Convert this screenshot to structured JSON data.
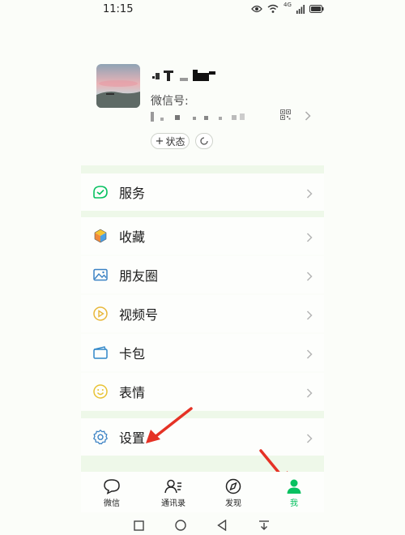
{
  "status_bar": {
    "time": "11:15",
    "network_label": "4G"
  },
  "profile": {
    "wechat_id_label": "微信号:",
    "status_button_label": "状态"
  },
  "menu": {
    "items": [
      {
        "label": "服务",
        "icon": "service-icon"
      },
      {
        "label": "收藏",
        "icon": "favorites-icon"
      },
      {
        "label": "朋友圈",
        "icon": "moments-icon"
      },
      {
        "label": "视频号",
        "icon": "channels-icon"
      },
      {
        "label": "卡包",
        "icon": "card-wallet-icon"
      },
      {
        "label": "表情",
        "icon": "sticker-icon"
      },
      {
        "label": "设置",
        "icon": "settings-icon"
      }
    ]
  },
  "tabs": [
    {
      "label": "微信",
      "icon": "chat-icon",
      "active": false
    },
    {
      "label": "通讯录",
      "icon": "contacts-icon",
      "active": false
    },
    {
      "label": "发现",
      "icon": "discover-icon",
      "active": false
    },
    {
      "label": "我",
      "icon": "me-icon",
      "active": true
    }
  ],
  "colors": {
    "accent": "#07c160",
    "annotation_arrow": "#e53225",
    "background": "#fbfdf9",
    "separator": "#eef8e9"
  }
}
